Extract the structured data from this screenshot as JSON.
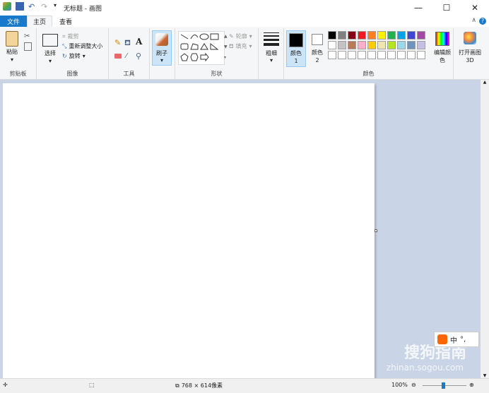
{
  "window": {
    "title": "无标题 - 画图",
    "minimize": "—",
    "maximize": "☐",
    "close": "✕",
    "collapse": "∧",
    "help": "?"
  },
  "tabs": {
    "file": "文件",
    "home": "主页",
    "view": "查看"
  },
  "clipboard": {
    "group": "剪贴板",
    "paste": "粘贴"
  },
  "image": {
    "group": "图像",
    "select": "选择",
    "crop": "裁剪",
    "resize": "重新调整大小",
    "rotate": "旋转"
  },
  "tools": {
    "group": "工具"
  },
  "brush": {
    "label": "刷子"
  },
  "shapes": {
    "group": "形状",
    "outline": "轮廓",
    "fill": "填充"
  },
  "size": {
    "label": "粗细"
  },
  "colors": {
    "group": "颜色",
    "color1": "颜色 1",
    "color2": "颜色 2",
    "edit": "编辑颜色",
    "palette_row1": [
      "#000000",
      "#7f7f7f",
      "#880015",
      "#ed1c24",
      "#ff7f27",
      "#fff200",
      "#22b14c",
      "#00a2e8",
      "#3f48cc",
      "#a349a4"
    ],
    "palette_row2": [
      "#ffffff",
      "#c3c3c3",
      "#b97a57",
      "#ffaec9",
      "#ffc90e",
      "#efe4b0",
      "#b5e61d",
      "#99d9ea",
      "#7092be",
      "#c8bfe7"
    ]
  },
  "paint3d": {
    "label": "打开画图 3D"
  },
  "status": {
    "dimensions": "768 × 614像素",
    "zoom": "100%"
  },
  "watermark": {
    "brand": "搜狗指南",
    "url": "zhinan.sogou.com"
  },
  "ime": {
    "lang": "中",
    "punct": "°,"
  }
}
